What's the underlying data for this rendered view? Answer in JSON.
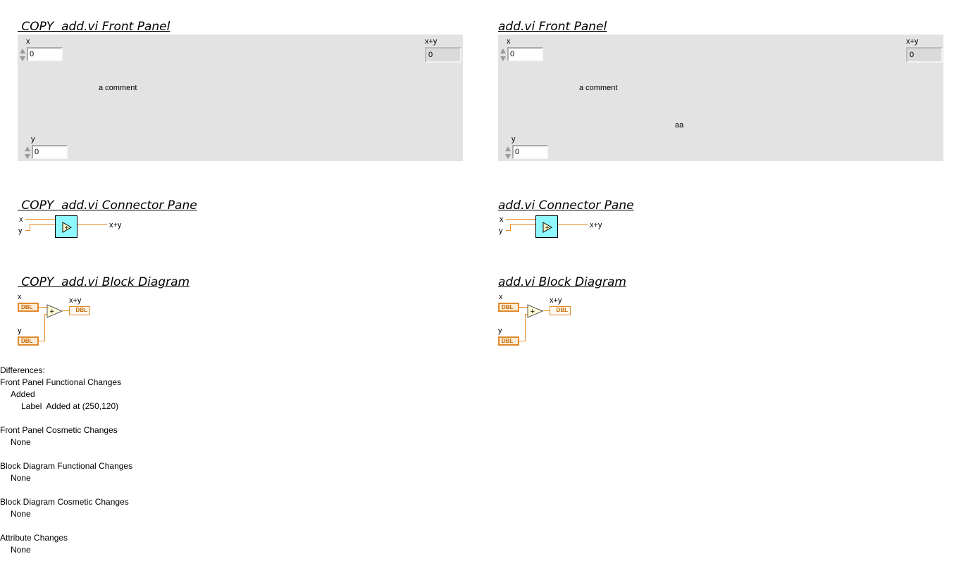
{
  "left": {
    "fp_title": " COPY  add.vi Front Panel",
    "cp_title": " COPY  add.vi Connector Pane",
    "bd_title": " COPY  add.vi Block Diagram",
    "x_label": "x",
    "x_value": "0",
    "y_label": "y",
    "y_value": "0",
    "sum_label": "x+y",
    "sum_value": "0",
    "comment": "a comment",
    "cp_x": "x",
    "cp_y": "y",
    "cp_sum": "x+y",
    "bd_x": "x",
    "bd_y": "y",
    "bd_sum": "x+y",
    "dbl": "DBL",
    "add_op": "+"
  },
  "right": {
    "fp_title": "add.vi Front Panel",
    "cp_title": "add.vi Connector Pane",
    "bd_title": "add.vi Block Diagram",
    "x_label": "x",
    "x_value": "0",
    "y_label": "y",
    "y_value": "0",
    "sum_label": "x+y",
    "sum_value": "0",
    "comment": "a comment",
    "added_label": "aa",
    "cp_x": "x",
    "cp_y": "y",
    "cp_sum": "x+y",
    "bd_x": "x",
    "bd_y": "y",
    "bd_sum": "x+y",
    "dbl": "DBL",
    "add_op": "+"
  },
  "differences": {
    "heading": "Differences:",
    "fp_functional": "Front Panel Functional Changes",
    "added": "Added",
    "added_item": "Label  Added at (250,120)",
    "fp_cosmetic": "Front Panel Cosmetic Changes",
    "fp_cosmetic_val": "None",
    "bd_functional": "Block Diagram Functional Changes",
    "bd_functional_val": "None",
    "bd_cosmetic": "Block Diagram Cosmetic Changes",
    "bd_cosmetic_val": "None",
    "attr": "Attribute Changes",
    "attr_val": "None"
  },
  "colors": {
    "panel": "#e3e3e3",
    "wire": "#e88d2d",
    "connector_icon": "#8ff8ff"
  }
}
